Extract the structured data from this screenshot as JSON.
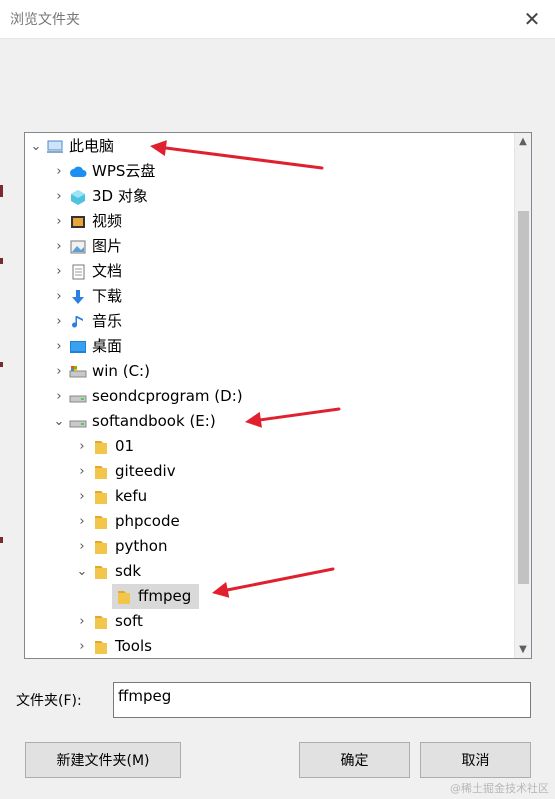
{
  "window": {
    "title": "浏览文件夹",
    "close_glyph": "✕"
  },
  "tree": {
    "expanded_glyph": "⌄",
    "collapsed_glyph": "›",
    "items": [
      {
        "label": "此电脑",
        "icon": "computer-icon",
        "expanded": true
      },
      {
        "label": "WPS云盘",
        "icon": "cloud-icon"
      },
      {
        "label": "3D 对象",
        "icon": "3d-objects-icon"
      },
      {
        "label": "视频",
        "icon": "video-icon"
      },
      {
        "label": "图片",
        "icon": "picture-icon"
      },
      {
        "label": "文档",
        "icon": "document-icon"
      },
      {
        "label": "下载",
        "icon": "download-icon"
      },
      {
        "label": "音乐",
        "icon": "music-icon"
      },
      {
        "label": "桌面",
        "icon": "desktop-icon"
      },
      {
        "label": "win (C:)",
        "icon": "system-drive-icon"
      },
      {
        "label": "seondcprogram (D:)",
        "icon": "drive-icon"
      },
      {
        "label": "softandbook (E:)",
        "icon": "drive-icon",
        "expanded": true
      },
      {
        "label": "01",
        "icon": "folder-icon"
      },
      {
        "label": "giteediv",
        "icon": "folder-icon"
      },
      {
        "label": "kefu",
        "icon": "folder-icon"
      },
      {
        "label": "phpcode",
        "icon": "folder-icon"
      },
      {
        "label": "python",
        "icon": "folder-icon"
      },
      {
        "label": "sdk",
        "icon": "folder-icon",
        "expanded": true
      },
      {
        "label": "ffmpeg",
        "icon": "folder-icon",
        "selected": true
      },
      {
        "label": "soft",
        "icon": "folder-icon"
      },
      {
        "label": "Tools",
        "icon": "folder-icon"
      }
    ]
  },
  "scrollbar": {
    "up_glyph": "▲",
    "down_glyph": "▼"
  },
  "folder_field": {
    "label": "文件夹(F):",
    "value": "ffmpeg"
  },
  "buttons": {
    "new_folder": "新建文件夹(M)",
    "ok": "确定",
    "cancel": "取消"
  },
  "watermark": "@稀土掘金技术社区",
  "colors": {
    "arrow": "#e0202e",
    "folder": "#f2c54b",
    "selection": "#d9d9d9"
  }
}
